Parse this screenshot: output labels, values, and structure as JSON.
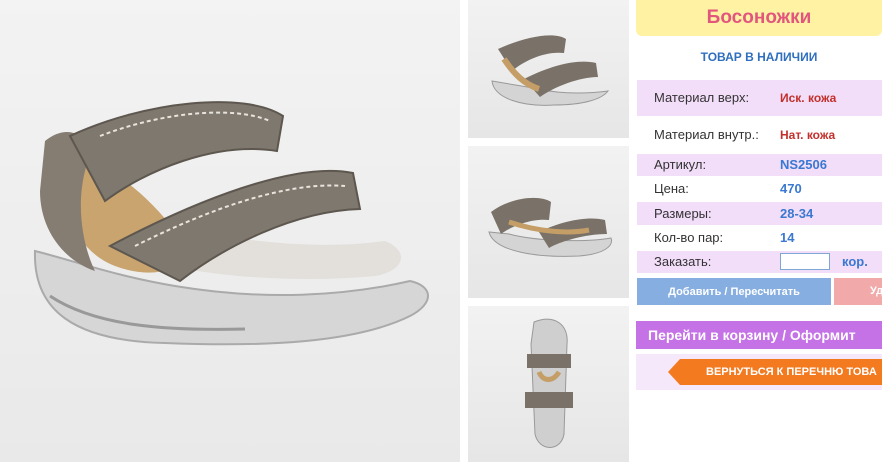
{
  "product": {
    "title": "Босоножки",
    "availability": "ТОВАР В НАЛИЧИИ"
  },
  "specs": {
    "material_upper_label": "Материал верх:",
    "material_upper_value": "Иск. кожа",
    "material_inner_label": "Материал внутр.:",
    "material_inner_value": "Нат. кожа",
    "sku_label": "Артикул:",
    "sku_value": "NS2506",
    "price_label": "Цена:",
    "price_value": "470",
    "sizes_label": "Размеры:",
    "sizes_value": "28-34",
    "pairs_label": "Кол-во пар:",
    "pairs_value": "14",
    "order_label": "Заказать:",
    "order_value": "",
    "order_unit": "кор."
  },
  "buttons": {
    "add": "Добавить / Пересчитать",
    "delete": "Уд",
    "cart": "Перейти в корзину / Оформит",
    "back": "ВЕРНУТЬСЯ К ПЕРЕЧНЮ ТОВА"
  },
  "colors": {
    "title_bg": "#fff3a3",
    "title_text": "#e2567e",
    "row_bg": "#f3defa",
    "accent_blue": "#3a78d1",
    "accent_red": "#c3302b",
    "cart_button": "#c472e6",
    "back_button": "#f47a20"
  }
}
